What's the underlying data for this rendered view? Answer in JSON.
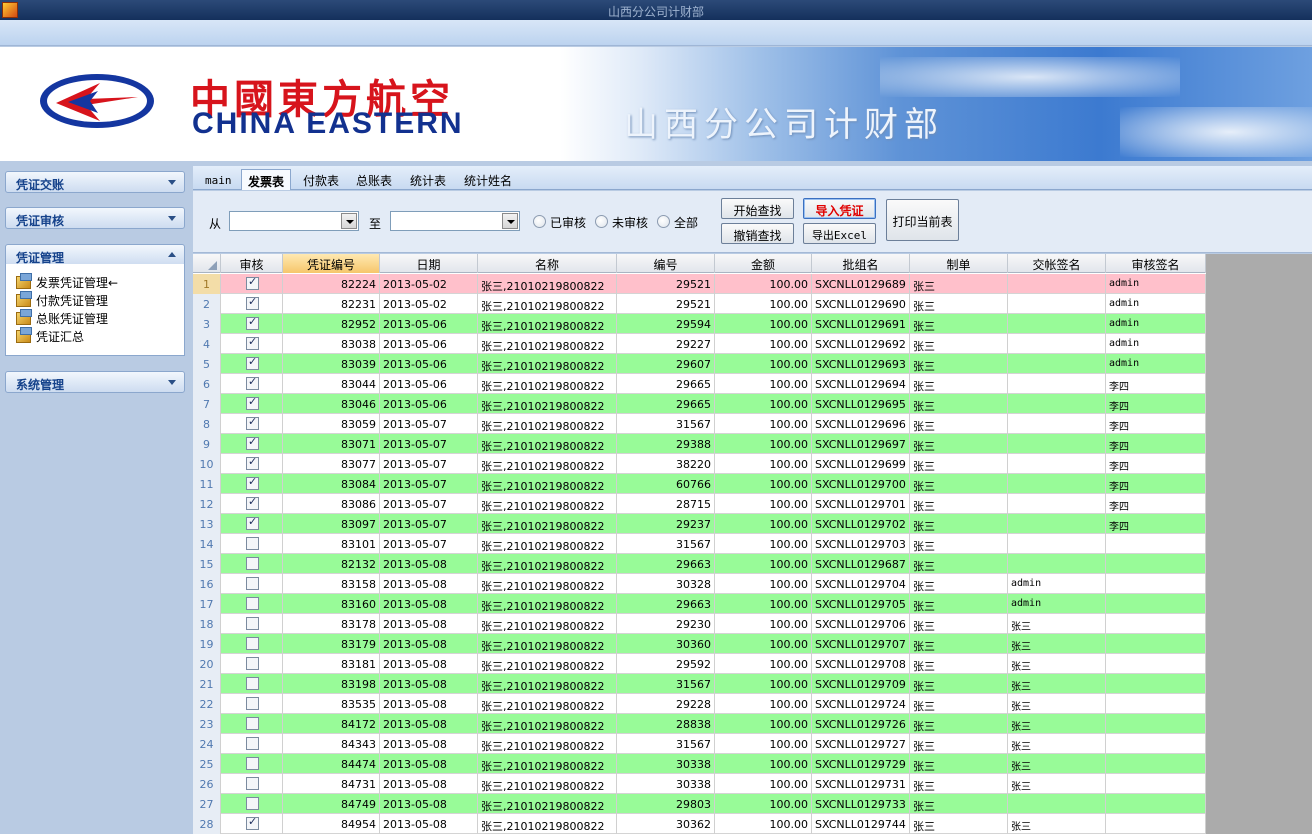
{
  "window": {
    "title": "山西分公司计财部"
  },
  "banner": {
    "brand_cn": "中國東方航空",
    "brand_en": "CHINA EASTERN",
    "department": "山西分公司计财部"
  },
  "sidebar": {
    "sections": [
      {
        "label": "凭证交账"
      },
      {
        "label": "凭证审核"
      },
      {
        "label": "凭证管理"
      },
      {
        "label": "系统管理"
      }
    ],
    "items": [
      {
        "label": "发票凭证管理←"
      },
      {
        "label": "付款凭证管理"
      },
      {
        "label": "总账凭证管理"
      },
      {
        "label": "凭证汇总"
      }
    ]
  },
  "tabs": [
    {
      "label": "main"
    },
    {
      "label": "发票表"
    },
    {
      "label": "付款表"
    },
    {
      "label": "总账表"
    },
    {
      "label": "统计表"
    },
    {
      "label": "统计姓名"
    }
  ],
  "filter": {
    "from_label": "从",
    "to_label": "至",
    "radio_audited": "已审核",
    "radio_unaudited": "未审核",
    "radio_all": "全部",
    "btn_search": "开始查找",
    "btn_cancel": "撤销查找",
    "btn_import": "导入凭证",
    "btn_export": "导出Excel",
    "btn_print": "打印当前表"
  },
  "table": {
    "columns": [
      "审核",
      "凭证编号",
      "日期",
      "名称",
      "编号",
      "金额",
      "批组名",
      "制单",
      "交帐签名",
      "审核签名"
    ],
    "rows": [
      {
        "n": "1",
        "chk": true,
        "id": "82224",
        "date": "2013-05-02",
        "name": "张三,21010219800822",
        "code": "29521",
        "amt": "100.00",
        "batch": "SXCNLL0129689",
        "maker": "张三",
        "sign": "",
        "audit": "admin",
        "bg": "p"
      },
      {
        "n": "2",
        "chk": true,
        "id": "82231",
        "date": "2013-05-02",
        "name": "张三,21010219800822",
        "code": "29521",
        "amt": "100.00",
        "batch": "SXCNLL0129690",
        "maker": "张三",
        "sign": "",
        "audit": "admin",
        "bg": "w"
      },
      {
        "n": "3",
        "chk": true,
        "id": "82952",
        "date": "2013-05-06",
        "name": "张三,21010219800822",
        "code": "29594",
        "amt": "100.00",
        "batch": "SXCNLL0129691",
        "maker": "张三",
        "sign": "",
        "audit": "admin",
        "bg": "g"
      },
      {
        "n": "4",
        "chk": true,
        "id": "83038",
        "date": "2013-05-06",
        "name": "张三,21010219800822",
        "code": "29227",
        "amt": "100.00",
        "batch": "SXCNLL0129692",
        "maker": "张三",
        "sign": "",
        "audit": "admin",
        "bg": "w"
      },
      {
        "n": "5",
        "chk": true,
        "id": "83039",
        "date": "2013-05-06",
        "name": "张三,21010219800822",
        "code": "29607",
        "amt": "100.00",
        "batch": "SXCNLL0129693",
        "maker": "张三",
        "sign": "",
        "audit": "admin",
        "bg": "g"
      },
      {
        "n": "6",
        "chk": true,
        "id": "83044",
        "date": "2013-05-06",
        "name": "张三,21010219800822",
        "code": "29665",
        "amt": "100.00",
        "batch": "SXCNLL0129694",
        "maker": "张三",
        "sign": "",
        "audit": "李四",
        "bg": "w"
      },
      {
        "n": "7",
        "chk": true,
        "id": "83046",
        "date": "2013-05-06",
        "name": "张三,21010219800822",
        "code": "29665",
        "amt": "100.00",
        "batch": "SXCNLL0129695",
        "maker": "张三",
        "sign": "",
        "audit": "李四",
        "bg": "g"
      },
      {
        "n": "8",
        "chk": true,
        "id": "83059",
        "date": "2013-05-07",
        "name": "张三,21010219800822",
        "code": "31567",
        "amt": "100.00",
        "batch": "SXCNLL0129696",
        "maker": "张三",
        "sign": "",
        "audit": "李四",
        "bg": "w"
      },
      {
        "n": "9",
        "chk": true,
        "id": "83071",
        "date": "2013-05-07",
        "name": "张三,21010219800822",
        "code": "29388",
        "amt": "100.00",
        "batch": "SXCNLL0129697",
        "maker": "张三",
        "sign": "",
        "audit": "李四",
        "bg": "g"
      },
      {
        "n": "10",
        "chk": true,
        "id": "83077",
        "date": "2013-05-07",
        "name": "张三,21010219800822",
        "code": "38220",
        "amt": "100.00",
        "batch": "SXCNLL0129699",
        "maker": "张三",
        "sign": "",
        "audit": "李四",
        "bg": "w"
      },
      {
        "n": "11",
        "chk": true,
        "id": "83084",
        "date": "2013-05-07",
        "name": "张三,21010219800822",
        "code": "60766",
        "amt": "100.00",
        "batch": "SXCNLL0129700",
        "maker": "张三",
        "sign": "",
        "audit": "李四",
        "bg": "g"
      },
      {
        "n": "12",
        "chk": true,
        "id": "83086",
        "date": "2013-05-07",
        "name": "张三,21010219800822",
        "code": "28715",
        "amt": "100.00",
        "batch": "SXCNLL0129701",
        "maker": "张三",
        "sign": "",
        "audit": "李四",
        "bg": "w"
      },
      {
        "n": "13",
        "chk": true,
        "id": "83097",
        "date": "2013-05-07",
        "name": "张三,21010219800822",
        "code": "29237",
        "amt": "100.00",
        "batch": "SXCNLL0129702",
        "maker": "张三",
        "sign": "",
        "audit": "李四",
        "bg": "g"
      },
      {
        "n": "14",
        "chk": false,
        "id": "83101",
        "date": "2013-05-07",
        "name": "张三,21010219800822",
        "code": "31567",
        "amt": "100.00",
        "batch": "SXCNLL0129703",
        "maker": "张三",
        "sign": "",
        "audit": "",
        "bg": "w"
      },
      {
        "n": "15",
        "chk": false,
        "id": "82132",
        "date": "2013-05-08",
        "name": "张三,21010219800822",
        "code": "29663",
        "amt": "100.00",
        "batch": "SXCNLL0129687",
        "maker": "张三",
        "sign": "",
        "audit": "",
        "bg": "g"
      },
      {
        "n": "16",
        "chk": false,
        "id": "83158",
        "date": "2013-05-08",
        "name": "张三,21010219800822",
        "code": "30328",
        "amt": "100.00",
        "batch": "SXCNLL0129704",
        "maker": "张三",
        "sign": "admin",
        "audit": "",
        "bg": "w"
      },
      {
        "n": "17",
        "chk": false,
        "id": "83160",
        "date": "2013-05-08",
        "name": "张三,21010219800822",
        "code": "29663",
        "amt": "100.00",
        "batch": "SXCNLL0129705",
        "maker": "张三",
        "sign": "admin",
        "audit": "",
        "bg": "g"
      },
      {
        "n": "18",
        "chk": false,
        "id": "83178",
        "date": "2013-05-08",
        "name": "张三,21010219800822",
        "code": "29230",
        "amt": "100.00",
        "batch": "SXCNLL0129706",
        "maker": "张三",
        "sign": "张三",
        "audit": "",
        "bg": "w"
      },
      {
        "n": "19",
        "chk": false,
        "id": "83179",
        "date": "2013-05-08",
        "name": "张三,21010219800822",
        "code": "30360",
        "amt": "100.00",
        "batch": "SXCNLL0129707",
        "maker": "张三",
        "sign": "张三",
        "audit": "",
        "bg": "g"
      },
      {
        "n": "20",
        "chk": false,
        "id": "83181",
        "date": "2013-05-08",
        "name": "张三,21010219800822",
        "code": "29592",
        "amt": "100.00",
        "batch": "SXCNLL0129708",
        "maker": "张三",
        "sign": "张三",
        "audit": "",
        "bg": "w"
      },
      {
        "n": "21",
        "chk": false,
        "id": "83198",
        "date": "2013-05-08",
        "name": "张三,21010219800822",
        "code": "31567",
        "amt": "100.00",
        "batch": "SXCNLL0129709",
        "maker": "张三",
        "sign": "张三",
        "audit": "",
        "bg": "g"
      },
      {
        "n": "22",
        "chk": false,
        "id": "83535",
        "date": "2013-05-08",
        "name": "张三,21010219800822",
        "code": "29228",
        "amt": "100.00",
        "batch": "SXCNLL0129724",
        "maker": "张三",
        "sign": "张三",
        "audit": "",
        "bg": "w"
      },
      {
        "n": "23",
        "chk": false,
        "id": "84172",
        "date": "2013-05-08",
        "name": "张三,21010219800822",
        "code": "28838",
        "amt": "100.00",
        "batch": "SXCNLL0129726",
        "maker": "张三",
        "sign": "张三",
        "audit": "",
        "bg": "g"
      },
      {
        "n": "24",
        "chk": false,
        "id": "84343",
        "date": "2013-05-08",
        "name": "张三,21010219800822",
        "code": "31567",
        "amt": "100.00",
        "batch": "SXCNLL0129727",
        "maker": "张三",
        "sign": "张三",
        "audit": "",
        "bg": "w"
      },
      {
        "n": "25",
        "chk": false,
        "id": "84474",
        "date": "2013-05-08",
        "name": "张三,21010219800822",
        "code": "30338",
        "amt": "100.00",
        "batch": "SXCNLL0129729",
        "maker": "张三",
        "sign": "张三",
        "audit": "",
        "bg": "g"
      },
      {
        "n": "26",
        "chk": false,
        "id": "84731",
        "date": "2013-05-08",
        "name": "张三,21010219800822",
        "code": "30338",
        "amt": "100.00",
        "batch": "SXCNLL0129731",
        "maker": "张三",
        "sign": "张三",
        "audit": "",
        "bg": "w"
      },
      {
        "n": "27",
        "chk": false,
        "id": "84749",
        "date": "2013-05-08",
        "name": "张三,21010219800822",
        "code": "29803",
        "amt": "100.00",
        "batch": "SXCNLL0129733",
        "maker": "张三",
        "sign": "",
        "audit": "",
        "bg": "g"
      },
      {
        "n": "28",
        "chk": true,
        "id": "84954",
        "date": "2013-05-08",
        "name": "张三,21010219800822",
        "code": "30362",
        "amt": "100.00",
        "batch": "SXCNLL0129744",
        "maker": "张三",
        "sign": "张三",
        "audit": "",
        "bg": "w"
      }
    ]
  },
  "colors": {
    "row_green": "#98fb98",
    "row_pink": "#ffc0cb",
    "accent": "#15428b"
  }
}
